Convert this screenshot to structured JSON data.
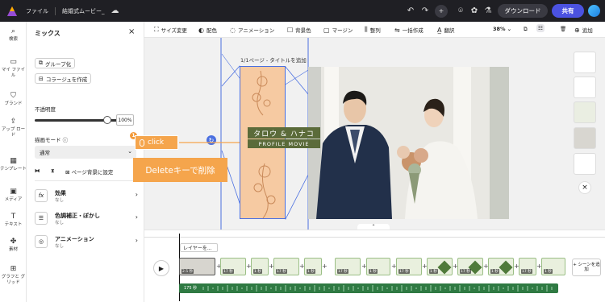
{
  "topbar": {
    "file_menu": "ファイル",
    "project_title": "結婚式ムービー_",
    "download_label": "ダウンロード",
    "share_label": "共有"
  },
  "rail": {
    "items": [
      {
        "label": "検索",
        "icon": "search-icon"
      },
      {
        "label": "マイ ファイル",
        "icon": "folder-icon"
      },
      {
        "label": "ブランド",
        "icon": "brand-icon"
      },
      {
        "label": "アップ ロード",
        "icon": "upload-icon"
      },
      {
        "label": "テンプレート",
        "icon": "template-icon"
      },
      {
        "label": "メディア",
        "icon": "media-icon"
      },
      {
        "label": "テキスト",
        "icon": "text-icon"
      },
      {
        "label": "素材",
        "icon": "elements-icon"
      },
      {
        "label": "グラフと グリッド",
        "icon": "grid-icon"
      }
    ]
  },
  "panel": {
    "title": "ミックス",
    "group_button": "グループ化",
    "collage_button": "コラージュを作成",
    "opacity_label": "不透明度",
    "opacity_value": "100%",
    "blend_label": "描画モード",
    "blend_value": "通常",
    "page_bg_label": "ページ背景に設定",
    "effects": {
      "title": "効果",
      "sub": "なし"
    },
    "color": {
      "title": "色調補正・ぼかし",
      "sub": "なし"
    },
    "animation": {
      "title": "アニメーション",
      "sub": "なし"
    }
  },
  "toolbar": {
    "resize": "サイズ変更",
    "color": "配色",
    "animation": "アニメーション",
    "bg_color": "背景色",
    "margin": "マージン",
    "align": "整列",
    "batch": "一括作成",
    "translate": "翻訳",
    "zoom": "38%",
    "add": "追加"
  },
  "canvas": {
    "page_label": "1/1ページ - タイトルを追加",
    "title_text": "タロウ & ハナコ",
    "subtitle_text": "PROFILE MOVIE"
  },
  "timeline": {
    "layer_label": "レイヤーを...",
    "first_duration": "2.5 秒",
    "durations": [
      "17 秒",
      "1 秒",
      "17 秒",
      "1 秒",
      "17 秒",
      "1 秒",
      "17 秒",
      "1 秒",
      "17 秒",
      "1 秒",
      "17 秒",
      "1 秒",
      "17 秒"
    ],
    "audio_label": "175 秒",
    "add_scene": "+ シーンを追加"
  },
  "overlay": {
    "step_number": "1",
    "click_text": "click",
    "delete_text": "Deleteキーで削除"
  },
  "colors": {
    "accent": "#4b52e0",
    "highlight": "#f5a54c",
    "selection": "#f6caa2",
    "audio": "#2f7a43"
  }
}
